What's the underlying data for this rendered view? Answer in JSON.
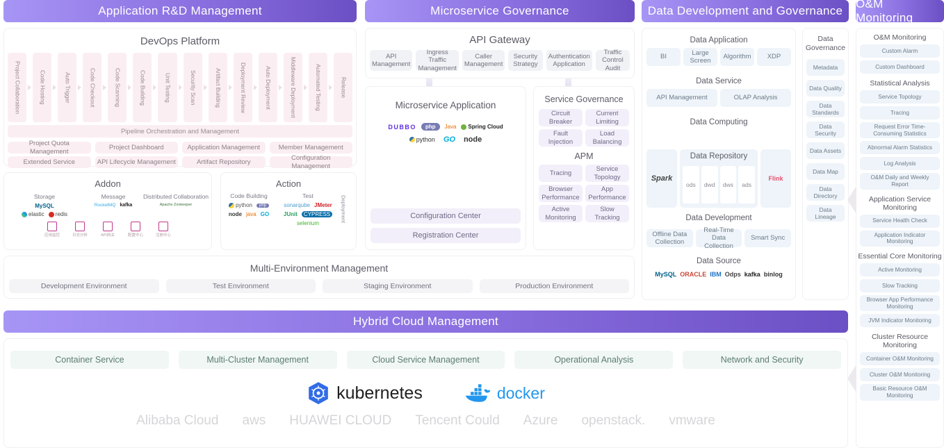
{
  "columns": {
    "app_rd": {
      "banner": "Application R&D Management",
      "devops": {
        "title": "DevOps Platform",
        "pipeline": [
          "Project Collaboration",
          "Code Hosting",
          "Auto Trigger",
          "Code Checkout",
          "Code Scanning",
          "Code Building",
          "Unit Testing",
          "Security Scan",
          "Artifact Building",
          "Deployment Review",
          "Auto Deployment",
          "Middleware Deployment",
          "Automated Testing",
          "Release"
        ],
        "pipeline_bar": "Pipeline Orchestration and Management",
        "features": [
          "Project Quota Management",
          "Project Dashboard",
          "Application Management",
          "Member Management",
          "Extended Service",
          "API Lifecycle Management",
          "Artifact Repository",
          "Configuration Management"
        ]
      },
      "addon": {
        "title": "Addon",
        "categories": [
          "Storage",
          "Message",
          "Distributed Collaboration"
        ],
        "storage_logos": [
          "MySQL",
          "elastic",
          "redis"
        ],
        "message_logos": [
          "RocketMQ",
          "kafka"
        ],
        "collab_logos": [
          "Apache Zookeeper"
        ],
        "tool_icons": [
          {
            "icon": "monitor-icon",
            "label": "应用监控"
          },
          {
            "icon": "log-icon",
            "label": "日志分析"
          },
          {
            "icon": "gateway-icon",
            "label": "API网关"
          },
          {
            "icon": "config-icon",
            "label": "配置中心"
          },
          {
            "icon": "registry-icon",
            "label": "注册中心"
          }
        ]
      },
      "action": {
        "title": "Action",
        "categories": [
          "Code Building",
          "Test"
        ],
        "side_label": "Deployment",
        "build_logos": [
          "python",
          "php",
          "node",
          "java",
          "GO"
        ],
        "test_logos": [
          "sonarqube",
          "JMeter",
          "JUnit",
          "CYPRESS",
          "selenium"
        ]
      },
      "multi_env": {
        "title": "Multi-Environment Management",
        "items": [
          "Development Environment",
          "Test Environment",
          "Staging Environment",
          "Production Environment"
        ]
      }
    },
    "microservice": {
      "banner": "Microservice Governance",
      "api_gateway": {
        "title": "API Gateway",
        "items": [
          "API Management",
          "Ingress Traffic Management",
          "Caller Management",
          "Security Strategy",
          "Authentication Application",
          "Traffic Control Audit"
        ]
      },
      "ms_app": {
        "title": "Microservice Application",
        "logos": [
          "DUBBO",
          "php",
          "Java",
          "Spring Cloud",
          "python",
          "GO",
          "node"
        ],
        "centers": [
          "Configuration Center",
          "Registration Center"
        ]
      },
      "service_governance": {
        "title": "Service Governance",
        "items": [
          "Circuit Breaker",
          "Current Limiting",
          "Fault Injection",
          "Load Balancing"
        ],
        "apm_title": "APM",
        "apm_items": [
          "Tracing",
          "Service Topology",
          "Browser Performance",
          "App Performance",
          "Active Monitoring",
          "Slow Tracking"
        ]
      }
    },
    "data": {
      "banner": "Data Development and Governance",
      "sections": [
        {
          "title": "Data Application",
          "items": [
            "BI",
            "Large Screen",
            "Algorithm",
            "XDP"
          ]
        },
        {
          "title": "Data Service",
          "items": [
            "API Management",
            "OLAP Analysis"
          ]
        },
        {
          "title": "Data Computing",
          "items": []
        },
        {
          "title": "Data Development",
          "items": [
            "Offline Data Collection",
            "Real-Time Data Collection",
            "Smart Sync"
          ]
        },
        {
          "title": "Data Source",
          "items": []
        }
      ],
      "data_repository": {
        "title": "Data Repository",
        "left_logo": "Spark",
        "right_logo": "Flink",
        "layers": [
          "ods",
          "dwd",
          "dws",
          "ads"
        ]
      },
      "data_source_logos": [
        "MySQL",
        "ORACLE",
        "IBM",
        "Odps",
        "kafka",
        "binlog"
      ],
      "governance": {
        "title": "Data Governance",
        "items": [
          "Metadata",
          "Data Quality",
          "Data Standards",
          "Data Security",
          "Data Assets",
          "Data Map",
          "Data Directory",
          "Data Lineage"
        ]
      }
    },
    "om": {
      "banner": "O&M Monitoring",
      "groups": [
        {
          "title": "O&M Monitoring",
          "items": [
            "Custom Alarm",
            "Custom Dashboard"
          ]
        },
        {
          "title": "Statistical Analysis",
          "items": [
            "Service Topology",
            "Tracing",
            "Request Error Time-Consuming Statistics",
            "Abnormal Alarm Statistics",
            "Log Analysis",
            "O&M Daily and Weekly Report"
          ]
        },
        {
          "title": "Application Service Monitoring",
          "items": [
            "Service Health Check",
            "Application Indicator Monitoring"
          ]
        },
        {
          "title": "Essential Core Monitoring",
          "items": [
            "Active Monitoring",
            "Slow Tracking",
            "Browser App Performance Monitoring",
            "JVM Indicator Monitoring"
          ]
        },
        {
          "title": "Cluster Resource Monitoring",
          "items": [
            "Container O&M Monitoring",
            "Cluster O&M Monitoring",
            "Basic Resource O&M Monitoring"
          ]
        }
      ]
    },
    "hybrid_cloud": {
      "banner": "Hybrid Cloud Management",
      "items": [
        "Container Service",
        "Multi-Cluster Management",
        "Cloud Service Management",
        "Operational Analysis",
        "Network and Security"
      ],
      "platform_logos": [
        "kubernetes",
        "docker"
      ],
      "cloud_vendors": [
        "Alibaba Cloud",
        "aws",
        "HUAWEI CLOUD",
        "Tencent Could",
        "Azure",
        "openstack.",
        "vmware"
      ]
    }
  },
  "colors": {
    "banner_start": "#a795f5",
    "banner_end": "#6b4fc4",
    "chip_pink": "#fbeef2",
    "chip_blue": "#eef4f9",
    "chip_grey": "#f3f1f8",
    "chip_green": "#f0f7f4"
  }
}
